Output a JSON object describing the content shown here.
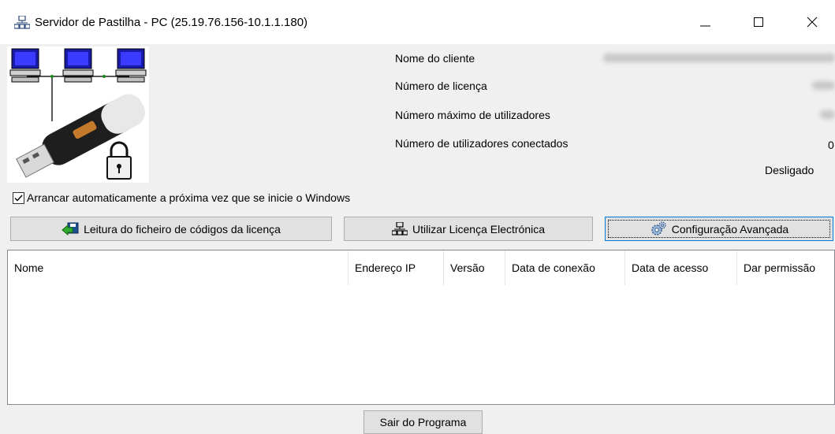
{
  "window": {
    "title": "Servidor de Pastilha - PC (25.19.76.156-10.1.1.180)",
    "controls": {
      "minimize": "minimize-icon",
      "maximize": "maximize-icon",
      "close": "close-icon"
    }
  },
  "logo": {
    "icon": "network-usb-dongle-lock-image"
  },
  "info": {
    "client_name_label": "Nome do cliente",
    "license_number_label": "Número de licença",
    "max_users_label": "Número máximo de utilizadores",
    "connected_users_label": "Número de utilizadores conectados",
    "connected_users_value": "0",
    "status": "Desligado"
  },
  "autostart": {
    "checked": true,
    "label": "Arrancar automaticamente a próxima vez que se inicie o Windows"
  },
  "buttons": {
    "read_license": "Leitura do ficheiro de códigos da licença",
    "electronic_license": "Utilizar Licença Electrónica",
    "advanced_config": "Configuração Avançada",
    "exit": "Sair do Programa"
  },
  "table": {
    "columns": [
      "Nome",
      "Endereço IP",
      "Versão",
      "Data de conexão",
      "Data de acesso",
      "Dar permissão"
    ],
    "rows": []
  },
  "colors": {
    "focus_border": "#0078d7",
    "button_bg": "#e1e1e1",
    "window_bg": "#f0f0f0"
  }
}
